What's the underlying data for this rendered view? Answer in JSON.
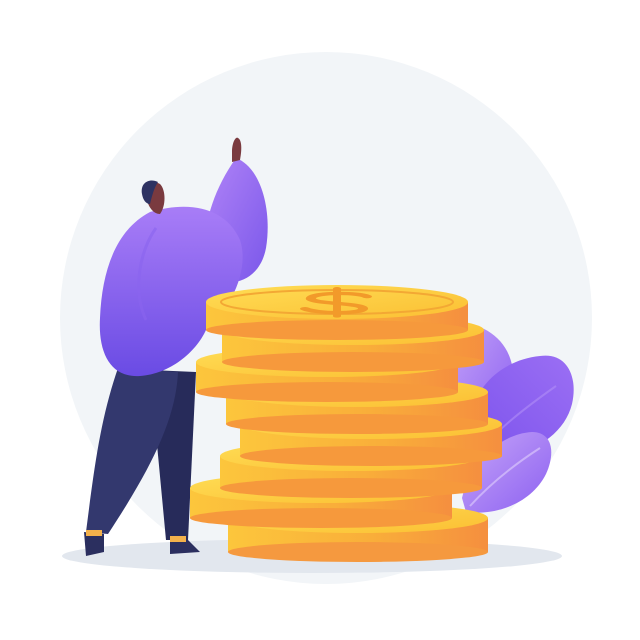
{
  "illustration": {
    "subject": "person-beside-gold-coin-stack",
    "icons": [
      "dollar-sign-icon"
    ]
  },
  "colors": {
    "background": "#ffffff",
    "backdrop_circle": "#f2f5f8",
    "ground_shadow": "#e2e7ee",
    "coin_face_light": "#ffd651",
    "coin_face_dark": "#f8b92e",
    "coin_edge_light": "#fcc03a",
    "coin_edge_dark": "#f6993c",
    "coin_rim": "#f29a2a",
    "sweater_light": "#a178f5",
    "sweater_dark": "#6d4ee6",
    "pants": "#33386e",
    "pants_shadow": "#272b5a",
    "skin": "#7a3a3f",
    "hair": "#2e3262",
    "shoe": "#f3b14b",
    "leaf_light": "#c7a6f8",
    "leaf_dark": "#8a5ef1"
  }
}
